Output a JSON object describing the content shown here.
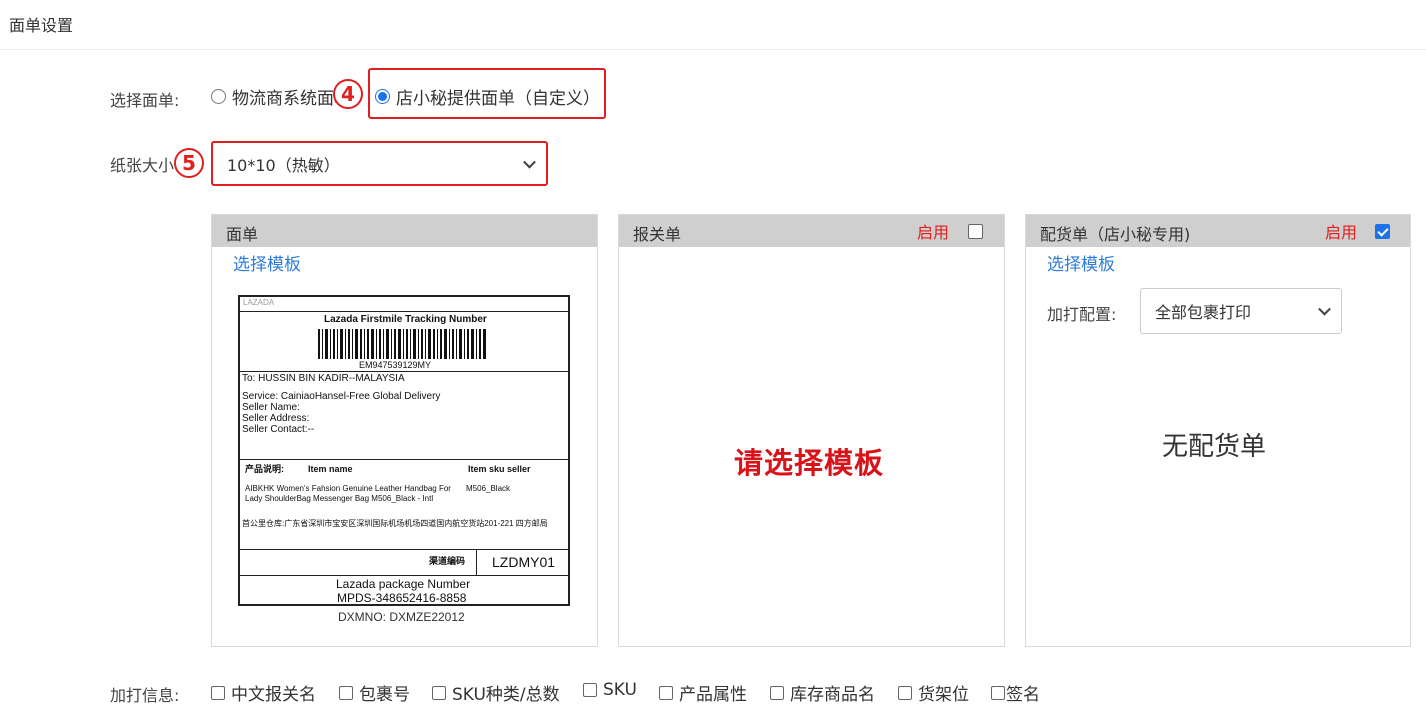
{
  "header": {
    "title": "面单设置"
  },
  "form": {
    "select_label": "选择面单:",
    "radio_system": "物流商系统面单",
    "radio_custom": "店小秘提供面单（自定义）",
    "paper_label": "纸张大小",
    "paper_value": "10*10（热敏）",
    "extra_label": "加打信息:"
  },
  "annotations": {
    "step4": "4",
    "step5": "5"
  },
  "panels": {
    "label": {
      "title": "面单",
      "link": "选择模板"
    },
    "customs": {
      "title": "报关单",
      "enable": "启用",
      "placeholder": "请选择模板"
    },
    "picking": {
      "title": "配货单（店小秘专用)",
      "enable": "启用",
      "link": "选择模板",
      "config_label": "加打配置:",
      "config_value": "全部包裹打印",
      "empty": "无配货单"
    }
  },
  "preview": {
    "brand": "LAZADA",
    "tracking_title": "Lazada Firstmile Tracking Number",
    "tracking_no": "EM947539129MY",
    "to": "To: HUSSIN BIN KADIR--MALAYSIA",
    "service": "Service: CainiaoHansel-Free Global Delivery",
    "seller_name": "Seller Name:",
    "seller_address": "Seller Address:",
    "seller_contact": "Seller Contact:--",
    "col_desc": "产品说明:",
    "col_item": "Item name",
    "col_sku": "Item sku seller",
    "item_desc": "AIBKHK Women's Fahsion Genuine Leather Handbag For Lady ShoulderBag Messenger Bag M506_Black - Intl",
    "item_sku": "M506_Black",
    "warehouse": "首公里仓库:广东省深圳市宝安区深圳国际机场机场四道国内航空货站201-221 四方邮局",
    "channel_label": "渠道编码",
    "channel_value": "LZDMY01",
    "pkg_title": "Lazada package Number",
    "pkg_no": "MPDS-348652416-8858",
    "dxmno": "DXMNO: DXMZE22012"
  },
  "extra_options": [
    "中文报关名",
    "包裹号",
    "SKU种类/总数",
    "SKU",
    "产品属性",
    "库存商品名",
    "货架位",
    "签名"
  ],
  "colors": {
    "highlight": "#e02020",
    "link": "#2f7bd6",
    "panel_head": "#cfcfcf",
    "radio_on": "#1a73e8"
  }
}
